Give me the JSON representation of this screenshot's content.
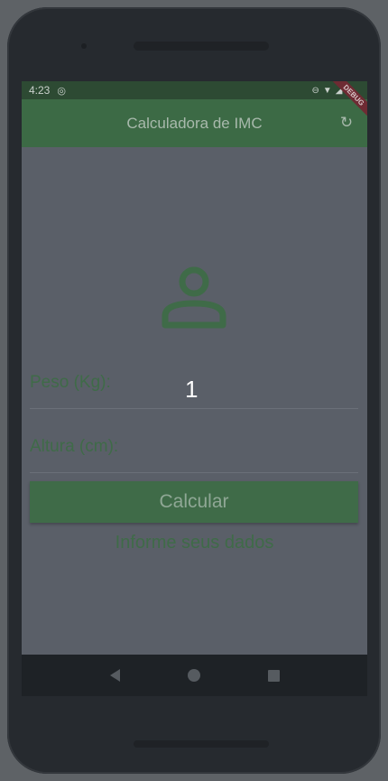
{
  "status_bar": {
    "time": "4:23"
  },
  "app_bar": {
    "title": "Calculadora de IMC",
    "debug_label": "DEBUG"
  },
  "form": {
    "peso_label": "Peso (Kg):",
    "peso_value": "",
    "altura_label": "Altura (cm):",
    "altura_value": ""
  },
  "overlay": {
    "number": "1"
  },
  "button": {
    "label": "Calcular"
  },
  "info": {
    "text": "Informe seus dados"
  },
  "colors": {
    "primary": "#3f6b48",
    "appbar": "#3c6a45",
    "background": "#5a5f68"
  },
  "icons": {
    "refresh": "refresh-icon",
    "person": "person-outline-icon",
    "back": "back-triangle-icon",
    "home": "home-circle-icon",
    "recent": "recent-square-icon"
  }
}
